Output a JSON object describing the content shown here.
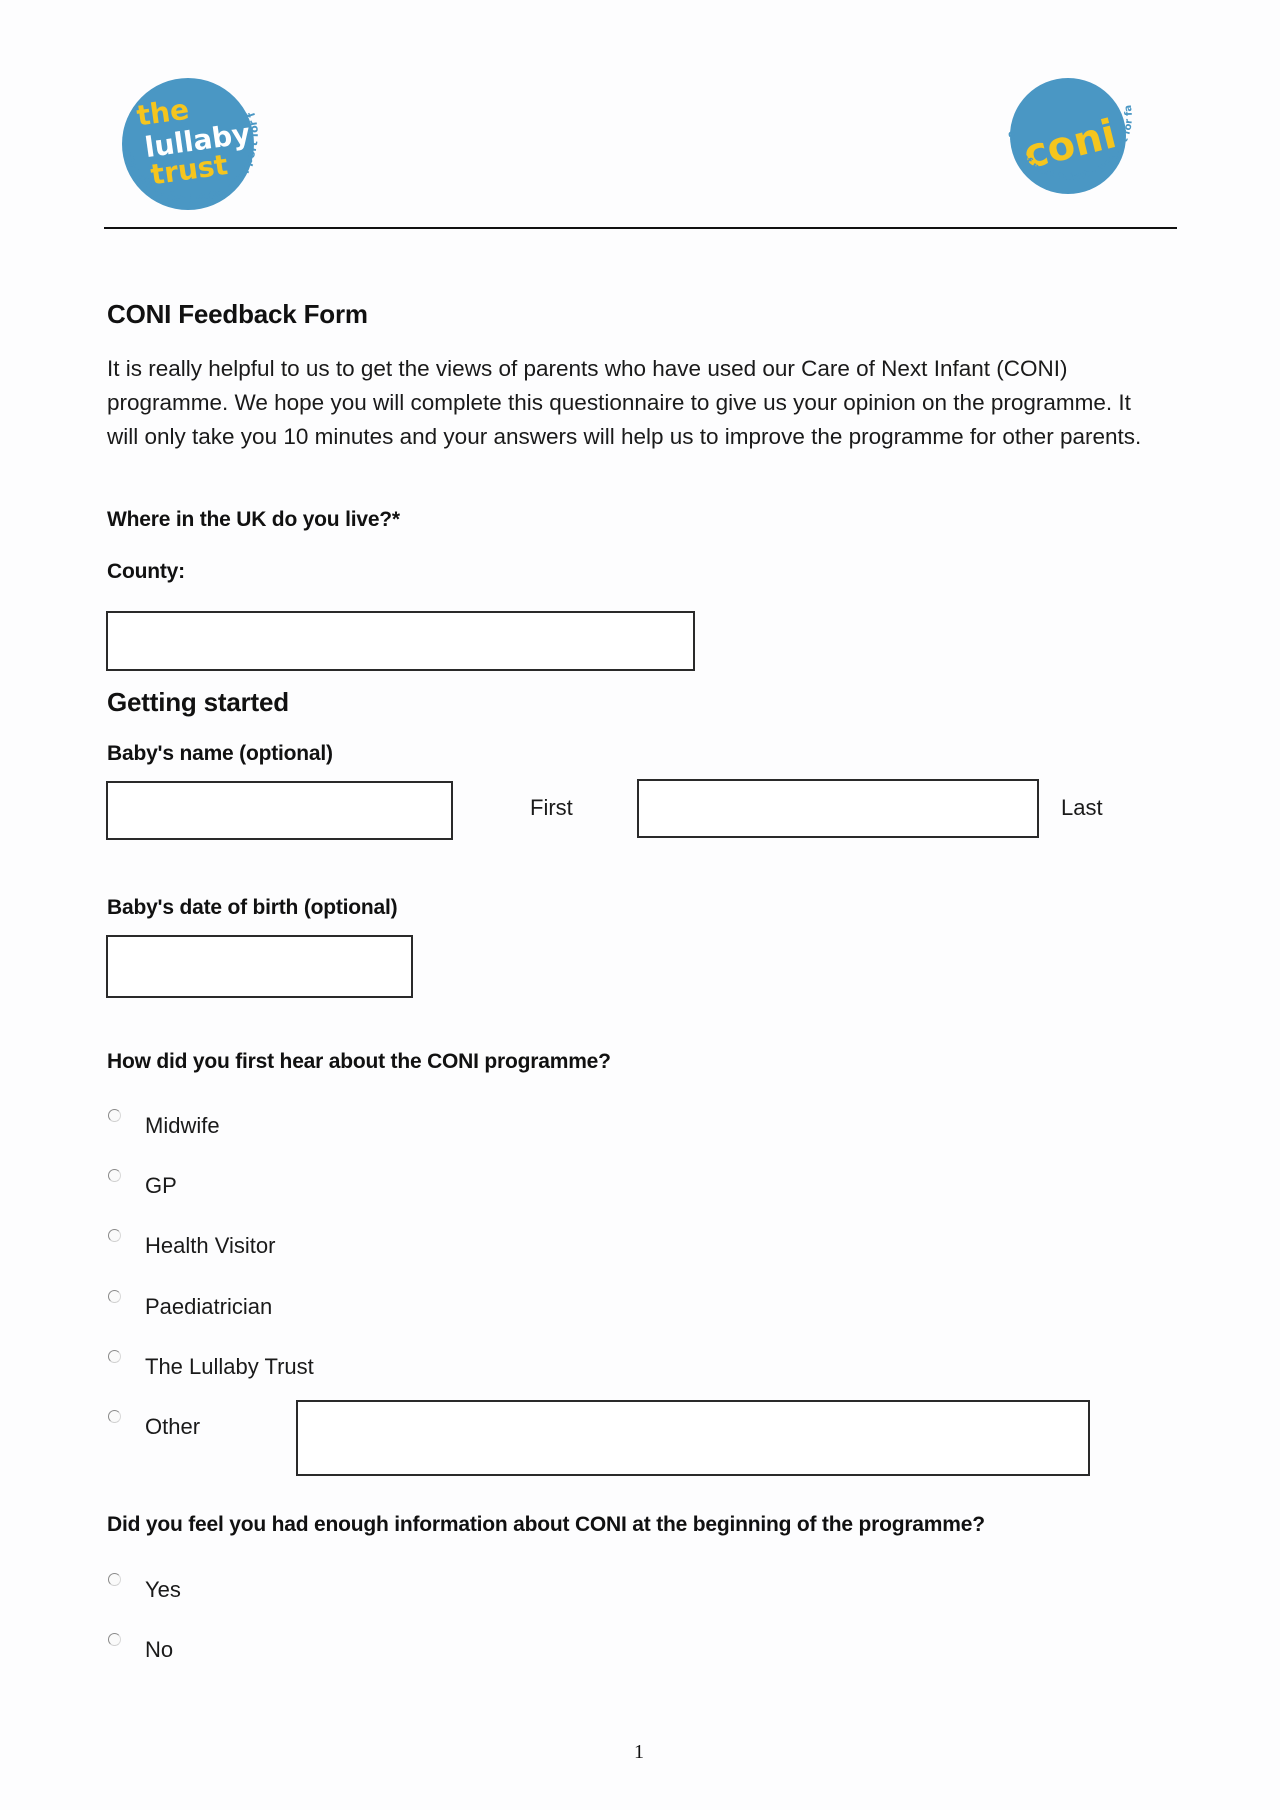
{
  "header": {
    "logo_left": {
      "name": "The Lullaby Trust",
      "line1": "the",
      "line2": "lullaby",
      "line3": "trust",
      "ring_text": "safer sleep for babies - support for families"
    },
    "logo_right": {
      "name": "CONI",
      "word": "coni",
      "ring_text": "care of next infant - support for families"
    },
    "colors": {
      "brand_blue": "#4a97c4",
      "brand_yellow": "#f5c51e"
    }
  },
  "form": {
    "title": "CONI Feedback Form",
    "intro": "It is really helpful to us to get the views of parents who have used our Care of Next Infant (CONI) programme. We hope you will complete this questionnaire to give us your opinion on the programme. It will only take you 10 minutes and your answers will help us to improve the programme for other parents.",
    "location_question": "Where in the UK do you live?*",
    "county_label": "County:",
    "county_value": "",
    "section_getting_started": "Getting started",
    "baby_name_label": "Baby's name (optional)",
    "first_name_value": "",
    "first_label": "First",
    "last_name_value": "",
    "last_label": "Last",
    "dob_label": "Baby's date of birth (optional)",
    "dob_value": "",
    "hear_question": "How did you first hear about the CONI programme?",
    "hear_options": [
      {
        "label": "Midwife",
        "selected": false
      },
      {
        "label": "GP",
        "selected": false
      },
      {
        "label": "Health Visitor",
        "selected": false
      },
      {
        "label": "Paediatrician",
        "selected": false
      },
      {
        "label": "The Lullaby Trust",
        "selected": false
      },
      {
        "label": "Other",
        "selected": false
      }
    ],
    "other_value": "",
    "info_question": "Did you feel you had enough information about CONI at the beginning of the programme?",
    "info_options": [
      {
        "label": "Yes",
        "selected": false
      },
      {
        "label": "No",
        "selected": false
      }
    ]
  },
  "footer": {
    "page_number": "1"
  }
}
